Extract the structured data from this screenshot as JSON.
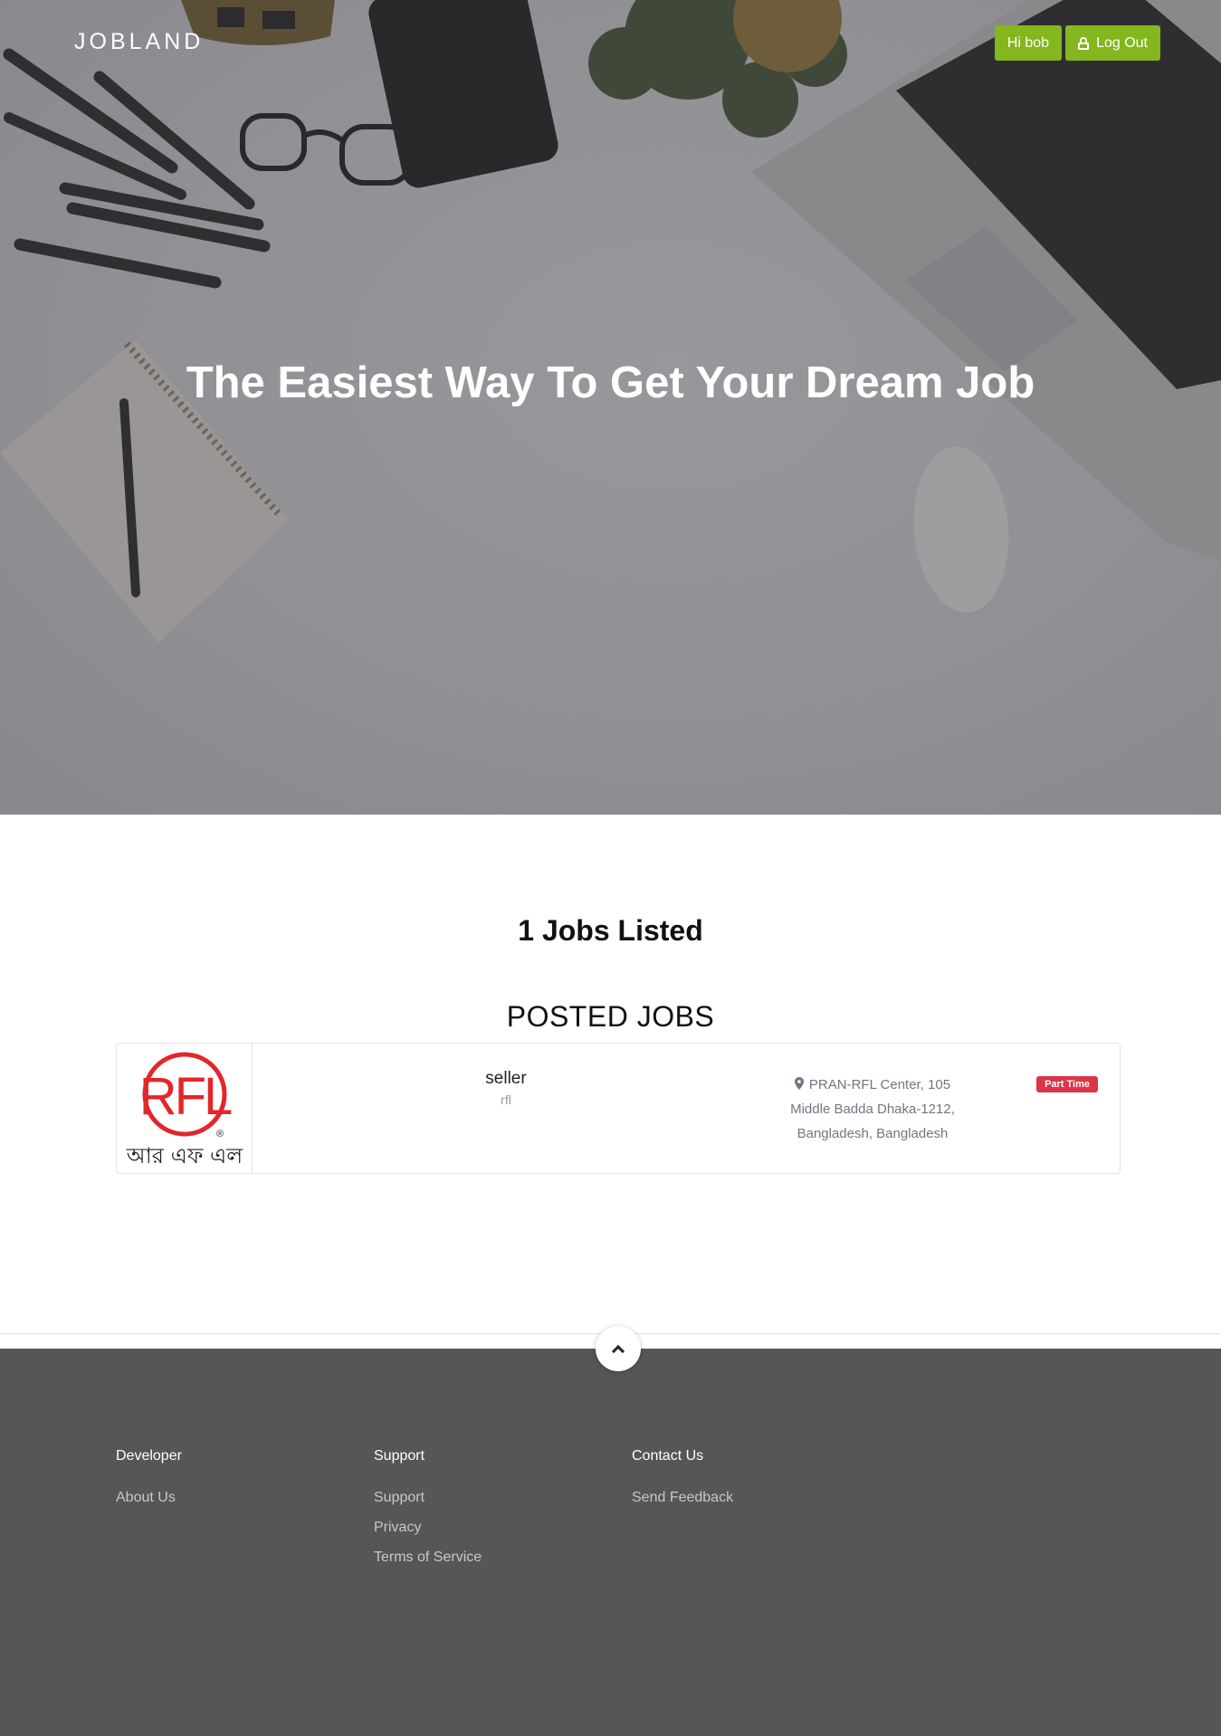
{
  "header": {
    "brand": "JOBLAND",
    "greeting_button": "Hi bob",
    "logout_button": "Log Out"
  },
  "hero": {
    "title": "The Easiest Way To Get Your Dream Job"
  },
  "jobs": {
    "count_heading": "1 Jobs Listed",
    "section_title": "POSTED JOBS",
    "items": [
      {
        "logo_text": "RFL",
        "logo_subtext": "আর এফ এল",
        "title": "seller",
        "company": "rfl",
        "location_line1": "PRAN-RFL Center, 105",
        "location_line2": "Middle Badda Dhaka-1212,",
        "location_line3": "Bangladesh, Bangladesh",
        "type": "Part Time"
      }
    ]
  },
  "footer": {
    "columns": [
      {
        "heading": "Developer",
        "links": [
          "About Us"
        ]
      },
      {
        "heading": "Support",
        "links": [
          "Support",
          "Privacy",
          "Terms of Service"
        ]
      },
      {
        "heading": "Contact Us",
        "links": [
          "Send Feedback"
        ]
      }
    ]
  },
  "colors": {
    "accent_green": "#84b61d",
    "badge_red": "#dc3545",
    "footer_bg": "#565656",
    "logo_red": "#e3262b"
  }
}
